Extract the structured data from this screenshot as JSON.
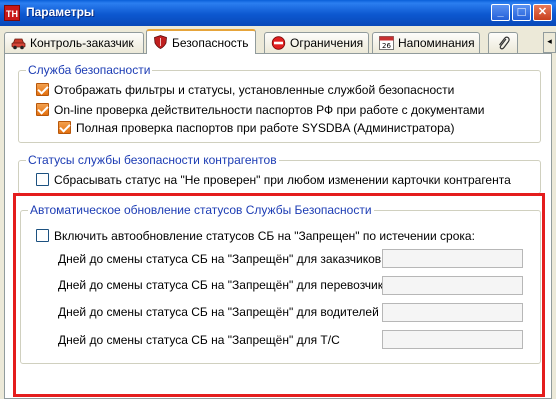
{
  "window": {
    "logo_text": "TH",
    "title": "Параметры",
    "minimize_glyph": "_",
    "maximize_glyph": "□",
    "close_glyph": "✕"
  },
  "tabs": [
    {
      "label": "Контроль-заказчик",
      "icon": "car-icon"
    },
    {
      "label": "Безопасность",
      "icon": "shield-icon",
      "active": true
    },
    {
      "label": "Ограничения",
      "icon": "no-entry-icon"
    },
    {
      "label": "Напоминания",
      "icon": "calendar-icon",
      "icon_text": "26"
    },
    {
      "label": "",
      "icon": "paperclip-icon"
    }
  ],
  "tab_scroll_glyph": "◂",
  "security_group": {
    "legend": "Служба безопасности",
    "items": [
      {
        "label": "Отображать фильтры и статусы, установленные службой безопасности",
        "checked": true
      },
      {
        "label": "On-line проверка действительности паспортов РФ при работе с документами",
        "checked": true
      },
      {
        "label": "Полная проверка паспортов при работе SYSDBA (Администратора)",
        "checked": true
      }
    ]
  },
  "contractor_group": {
    "legend": "Статусы службы безопасности контрагентов",
    "items": [
      {
        "label": "Сбрасывать статус на \"Не проверен\" при любом изменении карточки контрагента",
        "checked": false
      }
    ]
  },
  "auto_group": {
    "legend": "Автоматическое обновление статусов Службы Безопасности",
    "enable_label": "Включить автообновление статусов СБ на \"Запрещен\" по истечении срока:",
    "enable_checked": false,
    "fields": [
      {
        "label": "Дней до смены статуса СБ на \"Запрещён\" для заказчиков",
        "value": ""
      },
      {
        "label": "Дней до смены статуса СБ на \"Запрещён\" для перевозчиков",
        "value": ""
      },
      {
        "label": "Дней до смены статуса СБ на \"Запрещён\" для водителей",
        "value": ""
      },
      {
        "label": "Дней до смены статуса СБ на \"Запрещён\" для Т/С",
        "value": ""
      }
    ]
  },
  "colors": {
    "titlebar": "#0d58d0",
    "legend_text": "#1c3cb4",
    "checkbox_checked": "#e2700f",
    "highlight_border": "#e41d1d"
  }
}
